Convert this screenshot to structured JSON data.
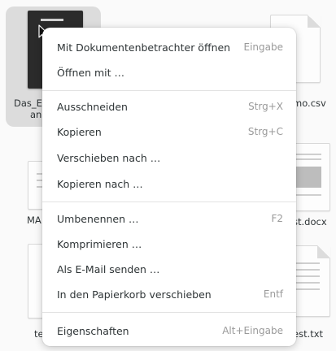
{
  "files": [
    {
      "label_line1": "Das_E",
      "label_line2": "and"
    },
    {
      "label": "mo.csv"
    },
    {
      "label": "MA"
    },
    {
      "label": "st.docx"
    },
    {
      "label": "te"
    },
    {
      "label": "est.txt"
    }
  ],
  "menu": {
    "groups": [
      [
        {
          "label": "Mit Dokumentenbetrachter öffnen",
          "accel": "Eingabe"
        },
        {
          "label": "Öffnen mit …",
          "accel": ""
        }
      ],
      [
        {
          "label": "Ausschneiden",
          "accel": "Strg+X"
        },
        {
          "label": "Kopieren",
          "accel": "Strg+C"
        },
        {
          "label": "Verschieben nach …",
          "accel": ""
        },
        {
          "label": "Kopieren nach …",
          "accel": ""
        }
      ],
      [
        {
          "label": "Umbenennen …",
          "accel": "F2"
        },
        {
          "label": "Komprimieren …",
          "accel": ""
        },
        {
          "label": "Als E-Mail senden …",
          "accel": ""
        },
        {
          "label": "In den Papierkorb verschieben",
          "accel": "Entf"
        }
      ],
      [
        {
          "label": "Eigenschaften",
          "accel": "Alt+Eingabe"
        }
      ]
    ]
  }
}
